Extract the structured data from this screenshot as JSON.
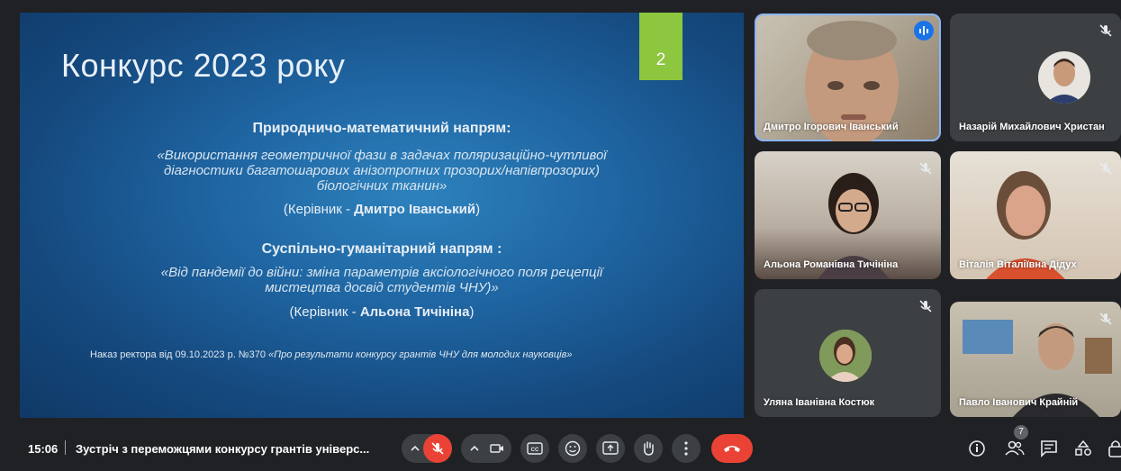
{
  "slide": {
    "title": "Конкурс 2023 року",
    "number": "2",
    "section1_heading": "Природничо-математичний напрям:",
    "section1_project_l1": "«Використання геометричної фази в задачах поляризаційно-чутливої",
    "section1_project_l2": "діагностики багатошарових анізотропних прозорих/напівпрозорих)",
    "section1_project_l3": "біологічних тканин»",
    "section1_leader_prefix": "(Керівник - ",
    "section1_leader_name": "Дмитро Іванський",
    "section1_leader_suffix": ")",
    "section2_heading": "Суспільно-гуманітарний напрям :",
    "section2_project_l1": "«Від пандемії до війни: зміна параметрів аксіологічного поля рецепції",
    "section2_project_l2": "мистецтва досвід студентів ЧНУ)»",
    "section2_leader_prefix": "(Керівник - ",
    "section2_leader_name": "Альона Тичініна",
    "section2_leader_suffix": ")",
    "order_prefix": "Наказ ректора від 09.10.2023 р. №370 ",
    "order_italic": "«Про результати конкурсу грантів ЧНУ для молодих науковців»"
  },
  "participants": [
    {
      "name": "Дмитро Ігорович Іванський",
      "state": "speaking"
    },
    {
      "name": "Назарій Михайлович Христан",
      "state": "muted"
    },
    {
      "name": "Альона Романівна Тичініна",
      "state": "muted"
    },
    {
      "name": "Віталія Віталіївна Дідух",
      "state": "muted"
    },
    {
      "name": "Уляна Іванівна Костюк",
      "state": "muted"
    },
    {
      "name": "Павло Іванович Крайній",
      "state": "muted"
    }
  ],
  "meeting": {
    "time": "15:06",
    "separator": "|",
    "title": "Зустріч з переможцями конкурсу грантів універс..."
  },
  "controls": [
    "mic-options",
    "mic-off",
    "camera-options",
    "camera",
    "captions",
    "emoji",
    "present",
    "raise-hand",
    "more-options",
    "leave-call"
  ],
  "right_controls": {
    "people_count": "7",
    "icons": [
      "info",
      "people",
      "chat",
      "activities",
      "host-controls"
    ]
  },
  "colors": {
    "accent_green": "#8dc63f",
    "leave_red": "#ea4335",
    "speaking_blue": "#1a73e8",
    "background": "#202124"
  }
}
